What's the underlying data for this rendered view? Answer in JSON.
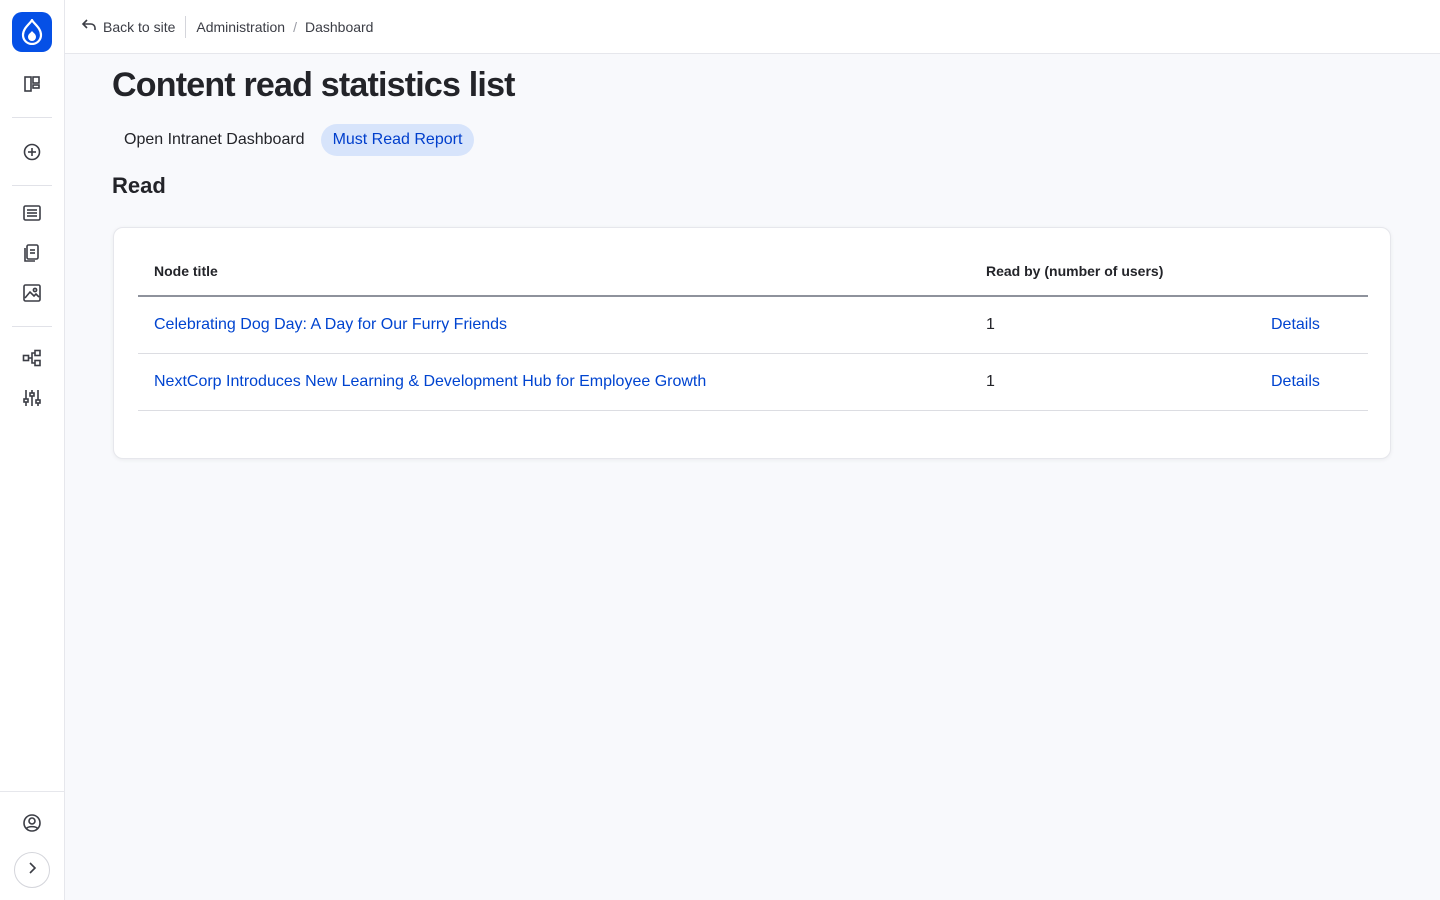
{
  "topbar": {
    "back_label": "Back to site",
    "breadcrumb": [
      "Administration",
      "Dashboard"
    ],
    "breadcrumb_separator": "/"
  },
  "page": {
    "title": "Content read statistics list",
    "tabs": [
      {
        "label": "Open Intranet Dashboard",
        "active": false
      },
      {
        "label": "Must Read Report",
        "active": true
      }
    ],
    "section_title": "Read"
  },
  "table": {
    "headers": [
      "Node title",
      "Read by (number of users)",
      ""
    ],
    "rows": [
      {
        "title": "Celebrating Dog Day: A Day for Our Furry Friends",
        "count": "1",
        "action": "Details"
      },
      {
        "title": "NextCorp Introduces New Learning & Development Hub for Employee Growth",
        "count": "1",
        "action": "Details"
      }
    ]
  },
  "sidebar": {
    "icons": [
      "drupal-logo-icon",
      "dashboard-icon",
      "add-content-icon",
      "content-icon",
      "files-icon",
      "media-icon",
      "structure-icon",
      "configuration-icon",
      "user-account-icon",
      "expand-icon"
    ]
  },
  "colors": {
    "brand": "#0550e6",
    "link": "#0044d0",
    "active_tab_bg": "#d7e4fb",
    "background": "#f8f9fc"
  }
}
